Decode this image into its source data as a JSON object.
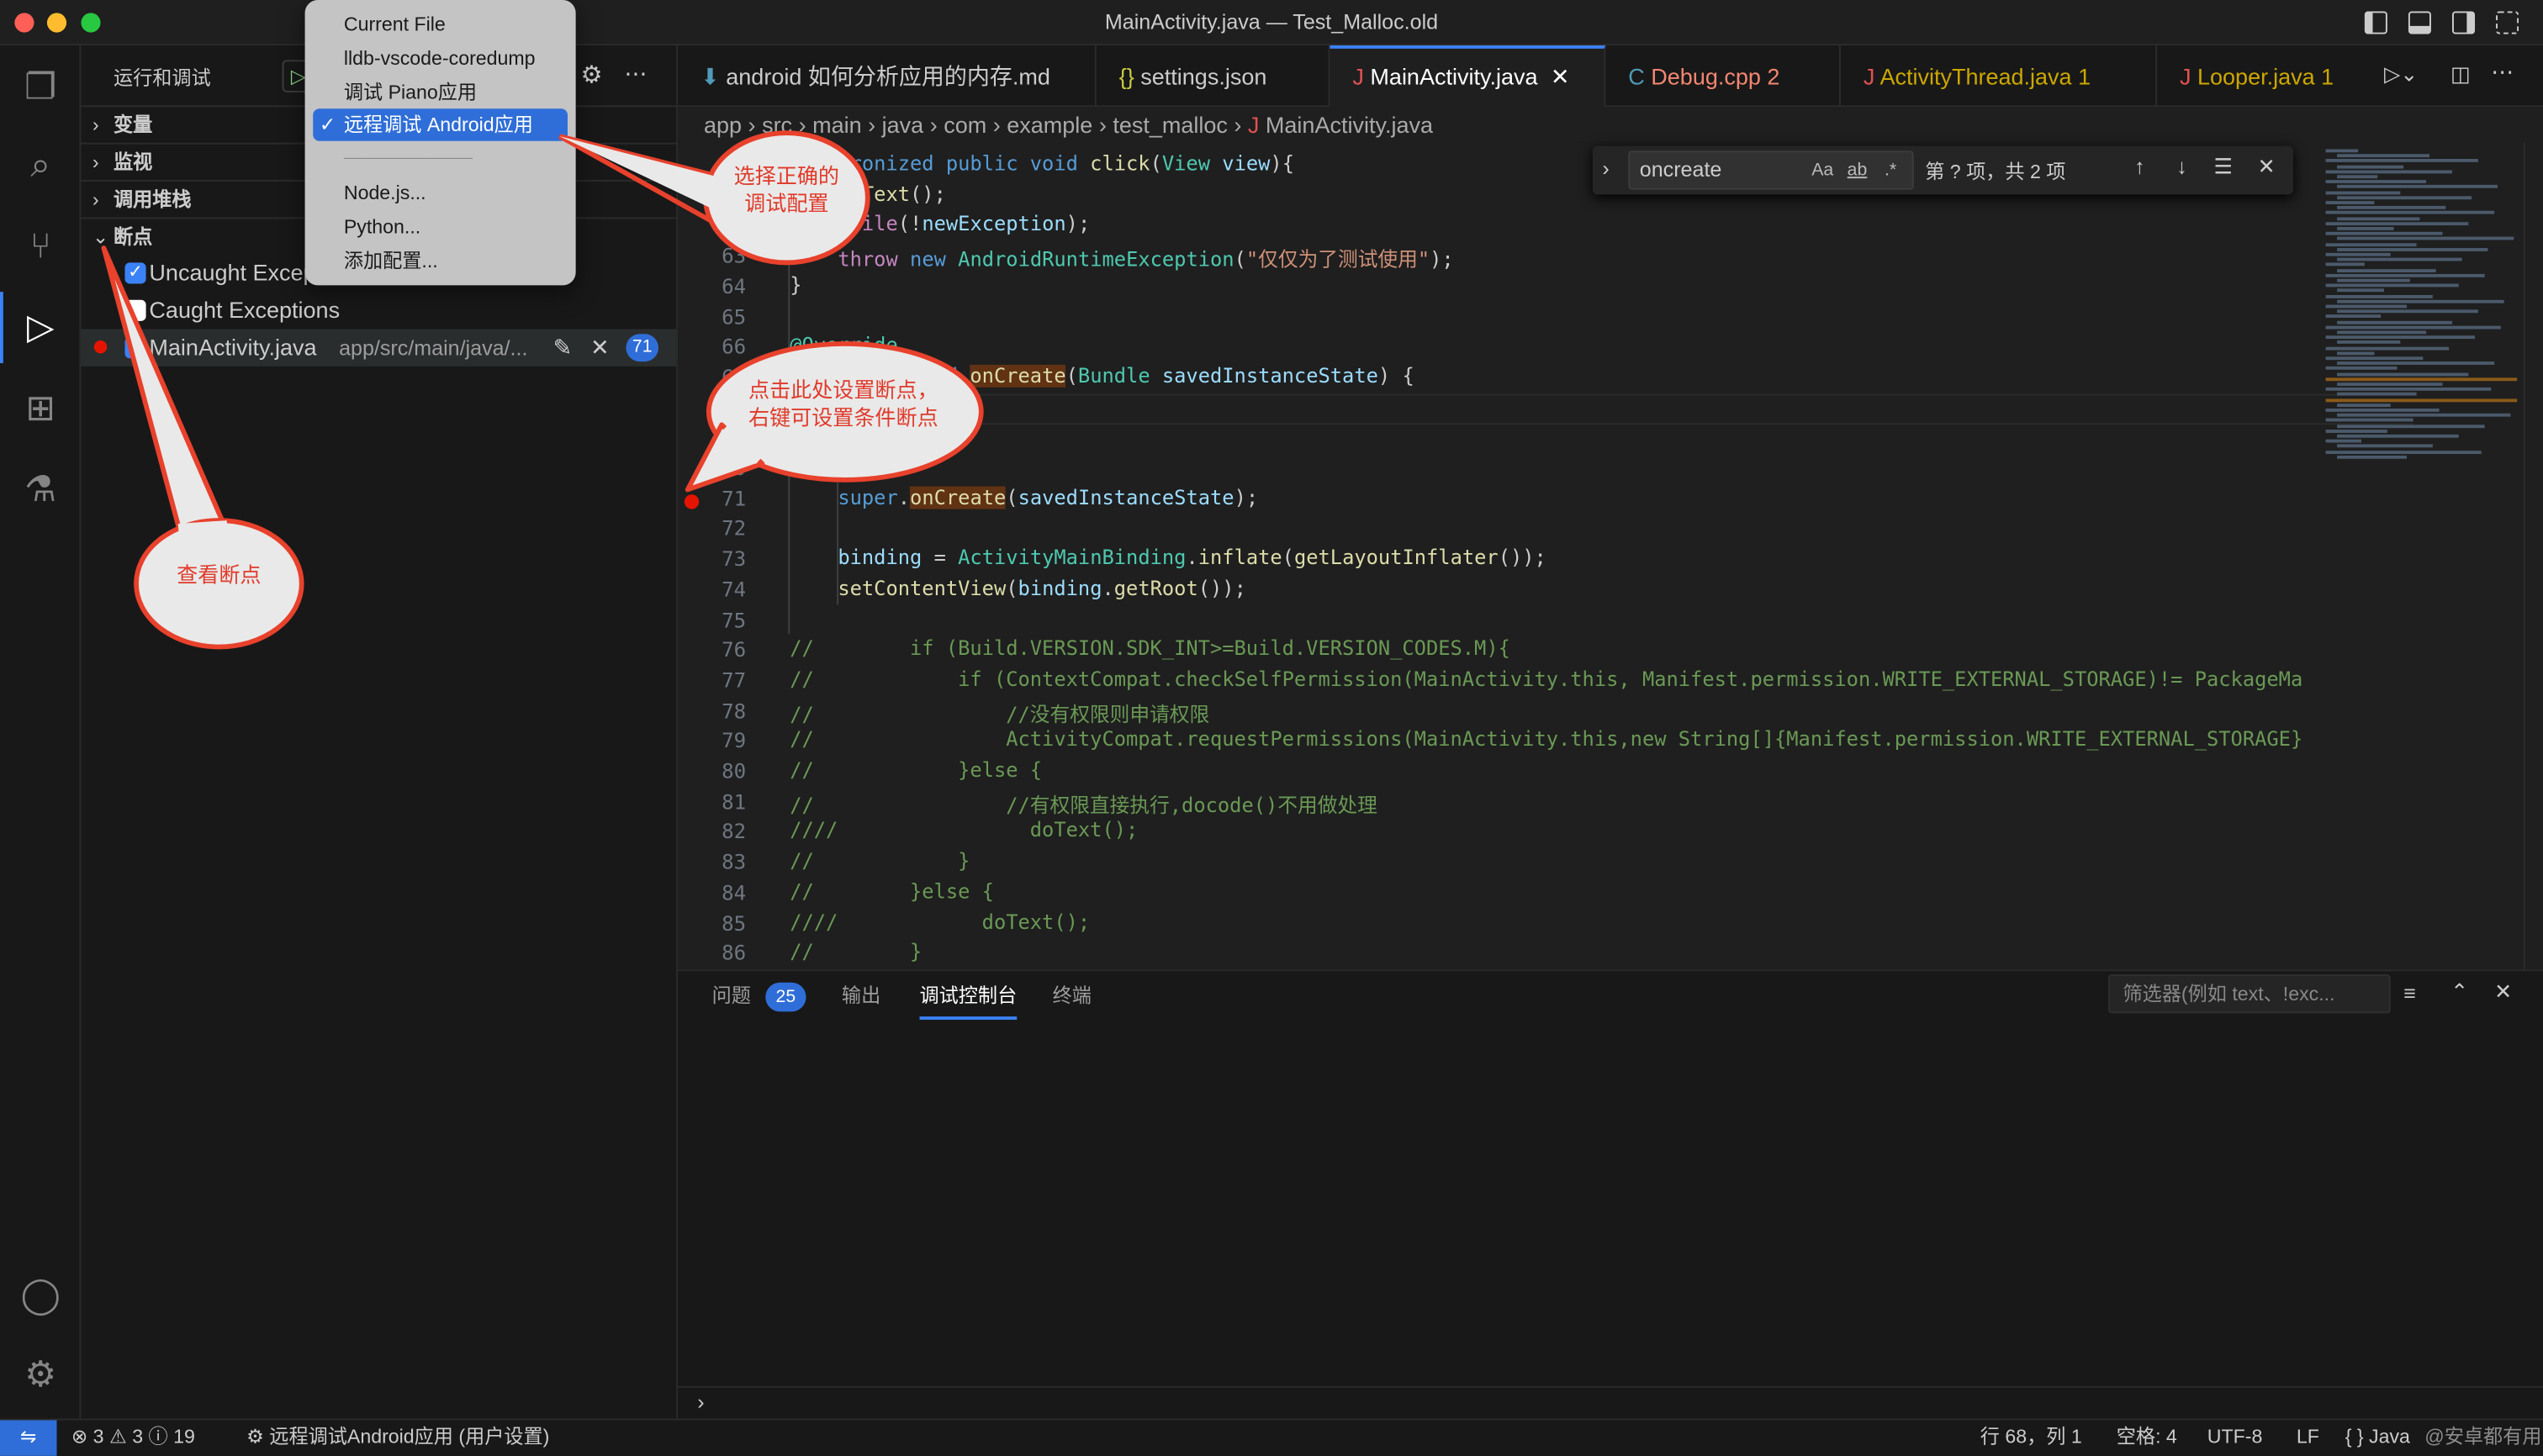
{
  "window": {
    "title": "MainActivity.java — Test_Malloc.old"
  },
  "sidebar": {
    "title": "运行和调试",
    "sections": [
      {
        "label": "变量"
      },
      {
        "label": "监视"
      },
      {
        "label": "调用堆栈"
      },
      {
        "label": "断点"
      }
    ],
    "breakpoints": [
      {
        "label": "Uncaught Exceptions",
        "visible": "Uncaught Exce",
        "checked": true
      },
      {
        "label": "Caught Exceptions",
        "checked": false
      },
      {
        "file": "MainActivity.java",
        "path": "app/src/main/java/...",
        "line": "71",
        "checked": true
      }
    ]
  },
  "launch_menu": {
    "items": [
      {
        "label": "Current File"
      },
      {
        "label": "lldb-vscode-coredump"
      },
      {
        "label": "调试 Piano应用"
      },
      {
        "label": "远程调试 Android应用",
        "selected": true
      },
      {
        "label": "──────────────"
      },
      {
        "label": "Node.js..."
      },
      {
        "label": "Python..."
      },
      {
        "label": "添加配置..."
      }
    ],
    "check": "✓"
  },
  "tabs": [
    {
      "label": "android 如何分析应用的内存.md",
      "icon": "markdown-icon",
      "color": "#cccccc"
    },
    {
      "label": "settings.json",
      "icon": "json-icon",
      "color": "#cccccc"
    },
    {
      "label": "MainActivity.java",
      "icon": "java-icon",
      "color": "#ffffff",
      "active": true
    },
    {
      "label": "Debug.cpp",
      "badge": "2",
      "icon": "cpp-icon",
      "color": "#f48771"
    },
    {
      "label": "ActivityThread.java",
      "badge": "1",
      "icon": "java-icon",
      "color": "#cca700"
    },
    {
      "label": "Looper.java",
      "badge": "1",
      "icon": "java-icon",
      "color": "#cca700"
    }
  ],
  "breadcrumb": [
    "app",
    "src",
    "main",
    "java",
    "com",
    "example",
    "test_malloc",
    "MainActivity.java"
  ],
  "find": {
    "query": "oncreate",
    "case": "Aa",
    "word": "ab",
    "regex": ".*",
    "result": "第 ? 项，共 2 项"
  },
  "code": [
    {
      "n": "60",
      "html": "<span class='kw'>synchronized public void</span> <span class='fn'>click</span>(<span class='ty'>View</span> <span class='vr'>view</span>){"
    },
    {
      "n": "61",
      "html": "    <span class='fn'>doText</span>();"
    },
    {
      "n": "62",
      "html": "    <span class='ctl'>while</span>(!<span class='vr'>newException</span>);"
    },
    {
      "n": "63",
      "html": "    <span class='ctl'>throw</span> <span class='kw'>new</span> <span class='ty'>AndroidRuntimeException</span>(<span class='st'>\"仅仅为了测试使用\"</span>);"
    },
    {
      "n": "64",
      "html": "}"
    },
    {
      "n": "65",
      "html": ""
    },
    {
      "n": "66",
      "html": "<span class='ty'>@Override</span>"
    },
    {
      "n": "67",
      "html": "<span class='kw'>protected void</span> <span class='fn hl'>onCreate</span>(<span class='ty'>Bundle</span> <span class='vr'>savedInstanceState</span>) {"
    },
    {
      "n": "68",
      "html": ""
    },
    {
      "n": "69",
      "html": ""
    },
    {
      "n": "70",
      "html": ""
    },
    {
      "n": "71",
      "html": "    <span class='kw'>super</span>.<span class='fn hl'>onCreate</span>(<span class='vr'>savedInstanceState</span>);"
    },
    {
      "n": "72",
      "html": ""
    },
    {
      "n": "73",
      "html": "    <span class='vr'>binding</span> = <span class='ty'>ActivityMainBinding</span>.<span class='fn'>inflate</span>(<span class='fn'>getLayoutInflater</span>());"
    },
    {
      "n": "74",
      "html": "    <span class='fn'>setContentView</span>(<span class='vr'>binding</span>.<span class='fn'>getRoot</span>());"
    },
    {
      "n": "75",
      "html": ""
    },
    {
      "n": "76",
      "html": "<span class='cm'>//        if (Build.VERSION.SDK_INT>=Build.VERSION_CODES.M){</span>"
    },
    {
      "n": "77",
      "html": "<span class='cm'>//            if (ContextCompat.checkSelfPermission(MainActivity.this, Manifest.permission.WRITE_EXTERNAL_STORAGE)!= PackageMa</span>"
    },
    {
      "n": "78",
      "html": "<span class='cm'>//                //没有权限则申请权限</span>"
    },
    {
      "n": "79",
      "html": "<span class='cm'>//                ActivityCompat.requestPermissions(MainActivity.this,new String[]{Manifest.permission.WRITE_EXTERNAL_STORAGE}</span>"
    },
    {
      "n": "80",
      "html": "<span class='cm'>//            }else {</span>"
    },
    {
      "n": "81",
      "html": "<span class='cm'>//                //有权限直接执行,docode()不用做处理</span>"
    },
    {
      "n": "82",
      "html": "<span class='cm'>////                doText();</span>"
    },
    {
      "n": "83",
      "html": "<span class='cm'>//            }</span>"
    },
    {
      "n": "84",
      "html": "<span class='cm'>//        }else {</span>"
    },
    {
      "n": "85",
      "html": "<span class='cm'>////            doText();</span>"
    },
    {
      "n": "86",
      "html": "<span class='cm'>//        }</span>"
    }
  ],
  "breakpoint_line": "71",
  "panel": {
    "tabs": [
      {
        "label": "问题",
        "badge": "25"
      },
      {
        "label": "输出"
      },
      {
        "label": "调试控制台",
        "active": true
      },
      {
        "label": "终端"
      }
    ],
    "filter_placeholder": "筛选器(例如 text、!exc..."
  },
  "status": {
    "errors": "3",
    "warnings": "3",
    "infos": "19",
    "launch": "远程调试Android应用 (用户设置)",
    "position": "行 68，列 1",
    "spaces": "空格: 4",
    "encoding": "UTF-8",
    "eol": "LF",
    "language": "{ } Java",
    "watermark": "@安卓都有用"
  },
  "callouts": [
    {
      "text": [
        "选择正确的",
        "调试配置"
      ]
    },
    {
      "text": [
        "点击此处设置断点，",
        "右键可设置条件断点"
      ]
    },
    {
      "text": [
        "查看断点"
      ]
    }
  ],
  "colors": {
    "accent": "#3b82f6",
    "callout_border": "#e8412c",
    "breakpoint": "#e51400"
  }
}
